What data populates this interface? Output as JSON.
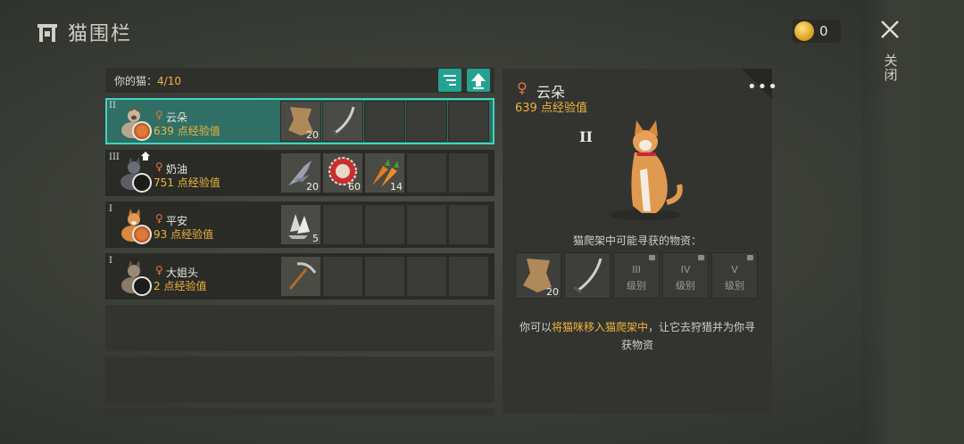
{
  "header": {
    "title": "猫围栏",
    "coins": "0",
    "close_label": "关闭"
  },
  "cats_panel": {
    "label": "你的猫：",
    "count": "4/10",
    "rows": [
      {
        "rank": "II",
        "name": "云朵",
        "xp": "639 点经验值",
        "plate": "full",
        "items": [
          {
            "icon": "leather-hide-icon",
            "qty": "20"
          },
          {
            "icon": "sword-icon",
            "qty": ""
          }
        ]
      },
      {
        "rank": "III",
        "name": "奶油",
        "xp": "751 点经验值",
        "plate": "empty",
        "home": true,
        "items": [
          {
            "icon": "feather-icon",
            "qty": "20"
          },
          {
            "icon": "bottle-cap-icon",
            "qty": "60"
          },
          {
            "icon": "carrot-icon",
            "qty": "14"
          }
        ]
      },
      {
        "rank": "I",
        "name": "平安",
        "xp": "93 点经验值",
        "plate": "full",
        "items": [
          {
            "icon": "crystal-icon",
            "qty": "5"
          }
        ]
      },
      {
        "rank": "I",
        "name": "大姐头",
        "xp": "2 点经验值",
        "plate": "empty",
        "items": [
          {
            "icon": "pickaxe-icon",
            "qty": ""
          }
        ]
      }
    ]
  },
  "detail": {
    "name": "云朵",
    "xp": "639 点经验值",
    "rank": "II",
    "more": "•••",
    "loot_title": "猫爬架中可能寻获的物资：",
    "loot": [
      {
        "icon": "leather-hide-icon",
        "qty": "20"
      },
      {
        "icon": "sword-icon",
        "qty": ""
      },
      {
        "numeral": "III",
        "level": "级别"
      },
      {
        "numeral": "IV",
        "level": "级别"
      },
      {
        "numeral": "V",
        "level": "级别"
      }
    ],
    "info_pre": "你可以",
    "info_hl": "将猫咪移入猫爬架中",
    "info_post": "，让它去狩猎并为你寻获物资"
  }
}
